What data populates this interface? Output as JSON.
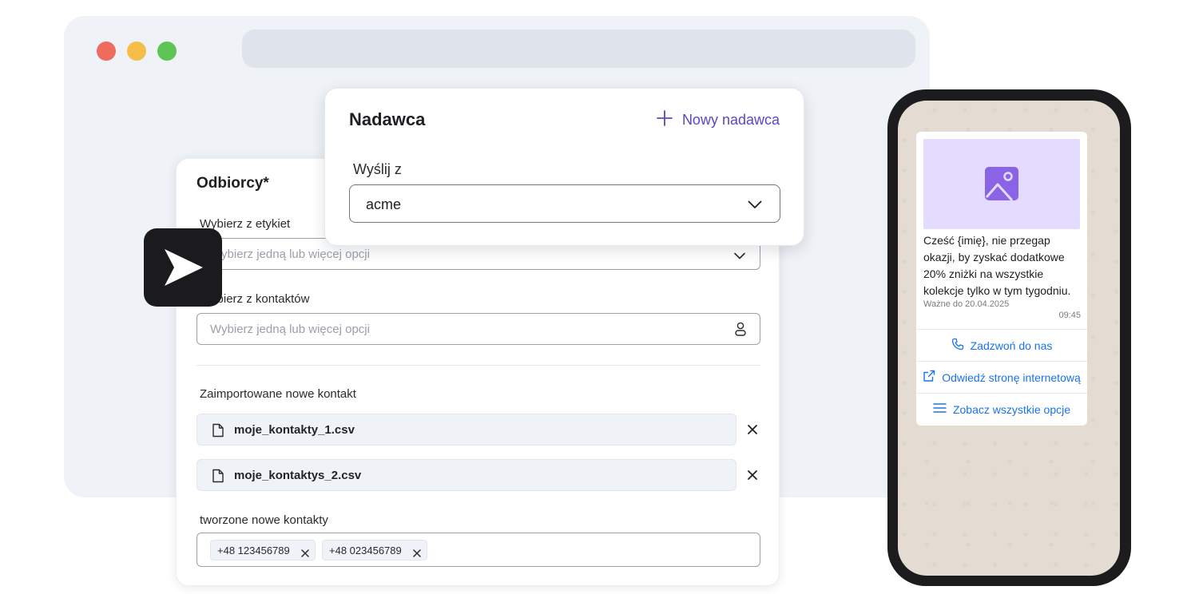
{
  "browser": {
    "controls": [
      "close",
      "minimize",
      "maximize"
    ]
  },
  "recipients": {
    "title": "Odbiorcy*",
    "tags_label": "Wybierz z etykiet",
    "tags_placeholder": "Wybierz jedną lub więcej opcji",
    "contacts_label": "Wybierz z kontaktów",
    "contacts_placeholder": "Wybierz jedną lub więcej opcji",
    "imported_label": "Zaimportowane nowe kontakt",
    "files": [
      "moje_kontakty_1.csv",
      "moje_kontaktys_2.csv"
    ],
    "created_label": "tworzone nowe kontakty",
    "phone_tags": [
      "+48 123456789",
      "+48 023456789"
    ]
  },
  "sender": {
    "title": "Nadawca",
    "new_sender_label": "Nowy nadawca",
    "send_from_label": "Wyślij z",
    "send_from_value": "acme"
  },
  "phone_preview": {
    "message_text": "Cześć {imię}, nie przegap okazji, by zyskać dodatkowe 20% zniżki na wszystkie kolekcje tylko w tym tygodniu.",
    "valid_until": "Ważne do 20.04.2025",
    "time": "09:45",
    "buttons": [
      "Zadzwoń do nas",
      "Odwiedź stronę internetową",
      "Zobacz wszystkie opcje"
    ]
  },
  "colors": {
    "accent": "#5b45c9",
    "link": "#1a73e8",
    "image_placeholder": "#e3dcff",
    "window_bg": "#eff2f7"
  },
  "icons": [
    "chevron-down-icon",
    "user-icon",
    "file-icon",
    "close-icon",
    "plus-icon",
    "send-icon",
    "image-icon",
    "phone-icon",
    "external-link-icon",
    "list-icon"
  ]
}
